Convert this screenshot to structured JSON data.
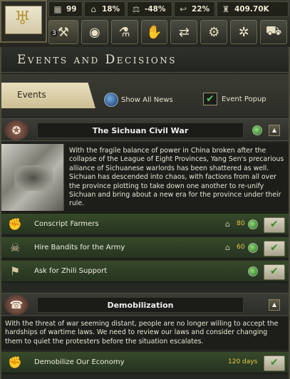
{
  "topbar": {
    "resources": [
      {
        "icon": "factory-icon",
        "value": "99"
      },
      {
        "icon": "stability-icon",
        "value": "18%"
      },
      {
        "icon": "scales-icon",
        "value": "-48%"
      },
      {
        "icon": "war-support-icon",
        "value": "22%"
      },
      {
        "icon": "manpower-icon",
        "value": "409.70K"
      }
    ],
    "menu_badge": "3",
    "menu_buttons": [
      "decisions-icon",
      "intelligence-icon",
      "research-icon",
      "diplomacy-icon",
      "trade-icon",
      "production-icon",
      "construction-icon",
      "logistics-icon"
    ]
  },
  "panel": {
    "title": "Events and Decisions",
    "tab_label": "Events",
    "show_all_news": "Show All News",
    "event_popup": "Event Popup"
  },
  "sichuan": {
    "title": "The Sichuan Civil War",
    "description": "With the fragile balance of power in China broken after the collapse of the League of Eight Provinces, Yang Sen's precarious alliance of Sichuanese warlords has been shattered as well. Sichuan has descended into chaos, with factions from all over the province plotting to take down one another to re-unify Sichuan and bring about a new era for the province under their rule.",
    "decisions": [
      {
        "label": "Conscript Farmers",
        "cost": "80"
      },
      {
        "label": "Hire Bandits for the Army",
        "cost": "60"
      },
      {
        "label": "Ask for Zhili Support",
        "cost": ""
      }
    ]
  },
  "demobilization": {
    "title": "Demobilization",
    "description": "With the threat of war seeming distant, people are no longer willing to accept the hardships of wartime laws. We need to review our laws and consider changing them to quiet the protesters before the situation escalates.",
    "decision_label": "Demobilize Our Economy",
    "decision_days": "120 days"
  },
  "colors": {
    "accent_green": "#4fc35a",
    "cost_yellow": "#e6c846"
  }
}
